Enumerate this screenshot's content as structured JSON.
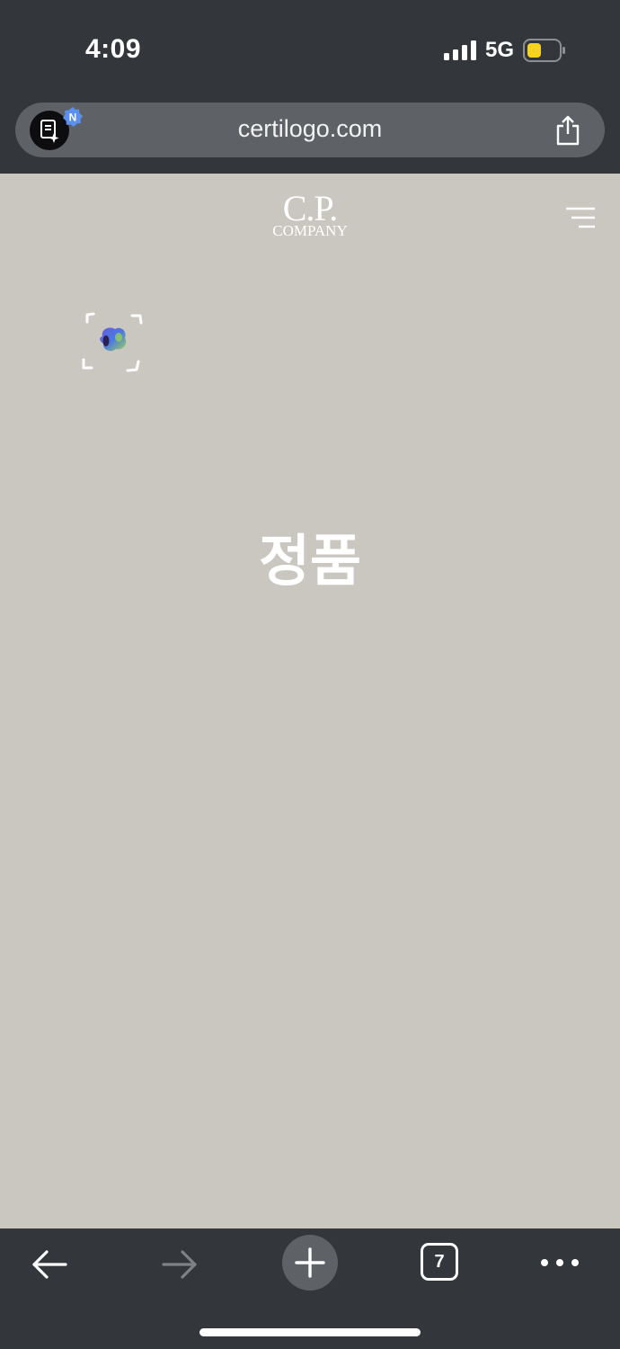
{
  "status_bar": {
    "time": "4:09",
    "network": "5G",
    "icons": [
      "signal-icon",
      "battery-icon"
    ],
    "battery_color": "#f5d21d"
  },
  "address_bar": {
    "url": "certilogo.com",
    "badge": "N",
    "icons": [
      "assistant-icon",
      "share-icon"
    ]
  },
  "page": {
    "brand_logo_top": "C.P.",
    "brand_logo_bottom": "COMPANY",
    "status_text": "정품",
    "background": "#cac7c0",
    "icons": [
      "menu-icon",
      "scan-icon"
    ]
  },
  "toolbar": {
    "tab_count": "7",
    "icons": [
      "back-arrow-icon",
      "forward-arrow-icon",
      "plus-icon",
      "tabs-icon",
      "more-icon"
    ]
  }
}
